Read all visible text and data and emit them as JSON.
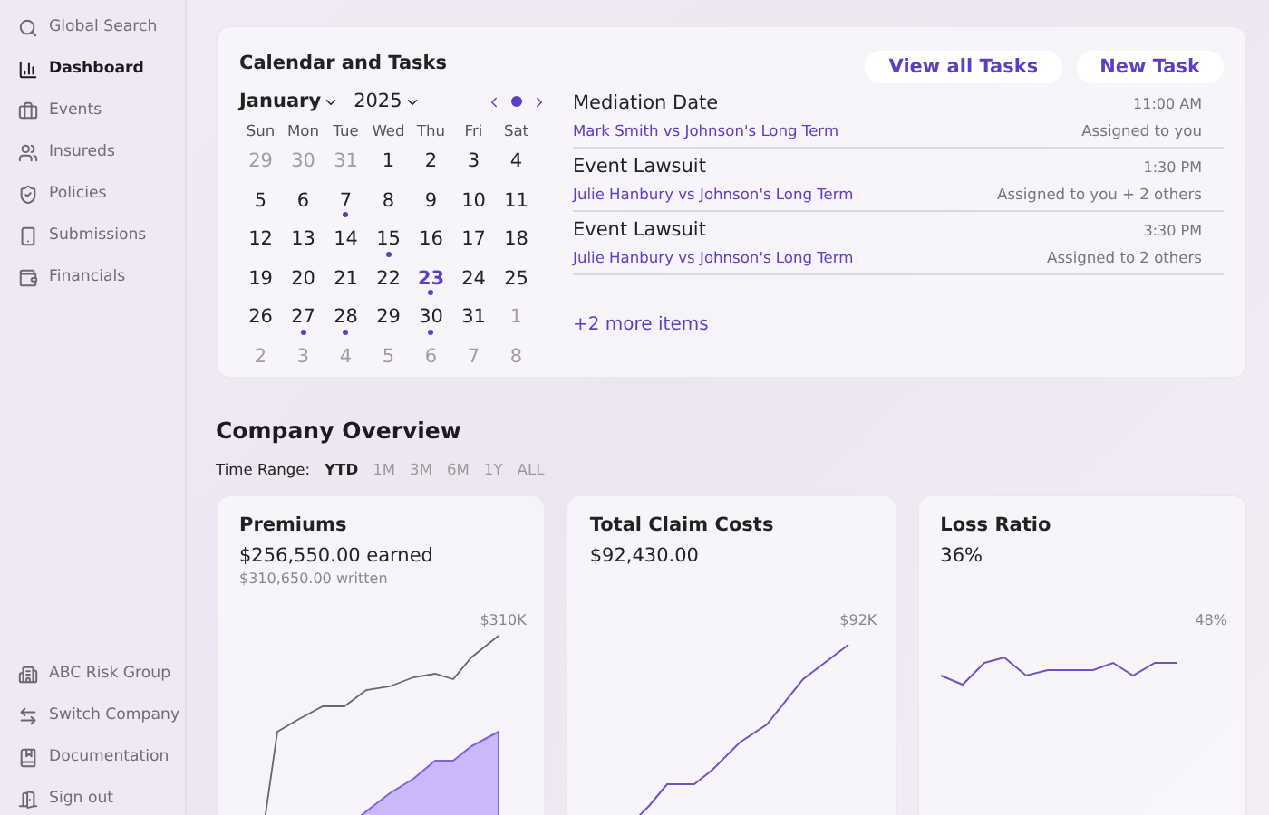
{
  "sidebar": {
    "items": [
      {
        "label": "Global Search",
        "selected": false
      },
      {
        "label": "Dashboard",
        "selected": true
      },
      {
        "label": "Events",
        "selected": false
      },
      {
        "label": "Insureds",
        "selected": false
      },
      {
        "label": "Policies",
        "selected": false
      },
      {
        "label": "Submissions",
        "selected": false
      },
      {
        "label": "Financials",
        "selected": false
      }
    ],
    "footer": [
      {
        "label": "ABC Risk Group"
      },
      {
        "label": "Switch Company"
      },
      {
        "label": "Documentation"
      },
      {
        "label": "Sign out"
      }
    ]
  },
  "calendar_card": {
    "title": "Calendar and Tasks",
    "buttons": [
      "View all Tasks",
      "New Task"
    ],
    "month": "January",
    "year": "2025",
    "weekdays": [
      "Sun",
      "Mon",
      "Tue",
      "Wed",
      "Thu",
      "Fri",
      "Sat"
    ],
    "weeks": [
      [
        {
          "d": "29",
          "muted": true
        },
        {
          "d": "30",
          "muted": true
        },
        {
          "d": "31",
          "muted": true
        },
        {
          "d": "1"
        },
        {
          "d": "2"
        },
        {
          "d": "3"
        },
        {
          "d": "4"
        }
      ],
      [
        {
          "d": "5"
        },
        {
          "d": "6"
        },
        {
          "d": "7",
          "event": true
        },
        {
          "d": "8"
        },
        {
          "d": "9"
        },
        {
          "d": "10"
        },
        {
          "d": "11"
        }
      ],
      [
        {
          "d": "12"
        },
        {
          "d": "13"
        },
        {
          "d": "14"
        },
        {
          "d": "15",
          "event": true
        },
        {
          "d": "16"
        },
        {
          "d": "17"
        },
        {
          "d": "18"
        }
      ],
      [
        {
          "d": "19"
        },
        {
          "d": "20"
        },
        {
          "d": "21"
        },
        {
          "d": "22"
        },
        {
          "d": "23",
          "event": true,
          "selected": true
        },
        {
          "d": "24"
        },
        {
          "d": "25"
        }
      ],
      [
        {
          "d": "26"
        },
        {
          "d": "27",
          "event": true
        },
        {
          "d": "28",
          "event": true
        },
        {
          "d": "29"
        },
        {
          "d": "30",
          "event": true
        },
        {
          "d": "31"
        },
        {
          "d": "1",
          "muted": true
        }
      ],
      [
        {
          "d": "2",
          "muted": true
        },
        {
          "d": "3",
          "muted": true
        },
        {
          "d": "4",
          "muted": true
        },
        {
          "d": "5",
          "muted": true
        },
        {
          "d": "6",
          "muted": true
        },
        {
          "d": "7",
          "muted": true
        },
        {
          "d": "8",
          "muted": true
        }
      ]
    ],
    "tasks": [
      {
        "title": "Mediation Date",
        "time": "11:00 AM",
        "case": "Mark Smith vs Johnson's Long Term",
        "assigned": "Assigned to you"
      },
      {
        "title": "Event Lawsuit",
        "time": "1:30 PM",
        "case": "Julie Hanbury vs Johnson's Long Term",
        "assigned": "Assigned to you + 2 others"
      },
      {
        "title": "Event Lawsuit",
        "time": "3:30 PM",
        "case": "Julie Hanbury vs Johnson's Long Term",
        "assigned": "Assigned to 2 others"
      }
    ],
    "more": "+2 more items"
  },
  "overview": {
    "title": "Company Overview",
    "range_label": "Time Range:",
    "ranges": [
      {
        "label": "YTD",
        "selected": true
      },
      {
        "label": "1M",
        "selected": false
      },
      {
        "label": "3M",
        "selected": false
      },
      {
        "label": "6M",
        "selected": false
      },
      {
        "label": "1Y",
        "selected": false
      },
      {
        "label": "ALL",
        "selected": false
      }
    ],
    "cards": [
      {
        "title": "Premiums",
        "value": "$256,550.00 earned",
        "sub": "$310,650.00 written",
        "end_label": "$310K",
        "kind": "area-line"
      },
      {
        "title": "Total Claim Costs",
        "value": "$92,430.00",
        "end_label": "$92K",
        "kind": "line"
      },
      {
        "title": "Loss Ratio",
        "value": "36%",
        "end_label": "48%",
        "kind": "flat-line"
      }
    ]
  }
}
